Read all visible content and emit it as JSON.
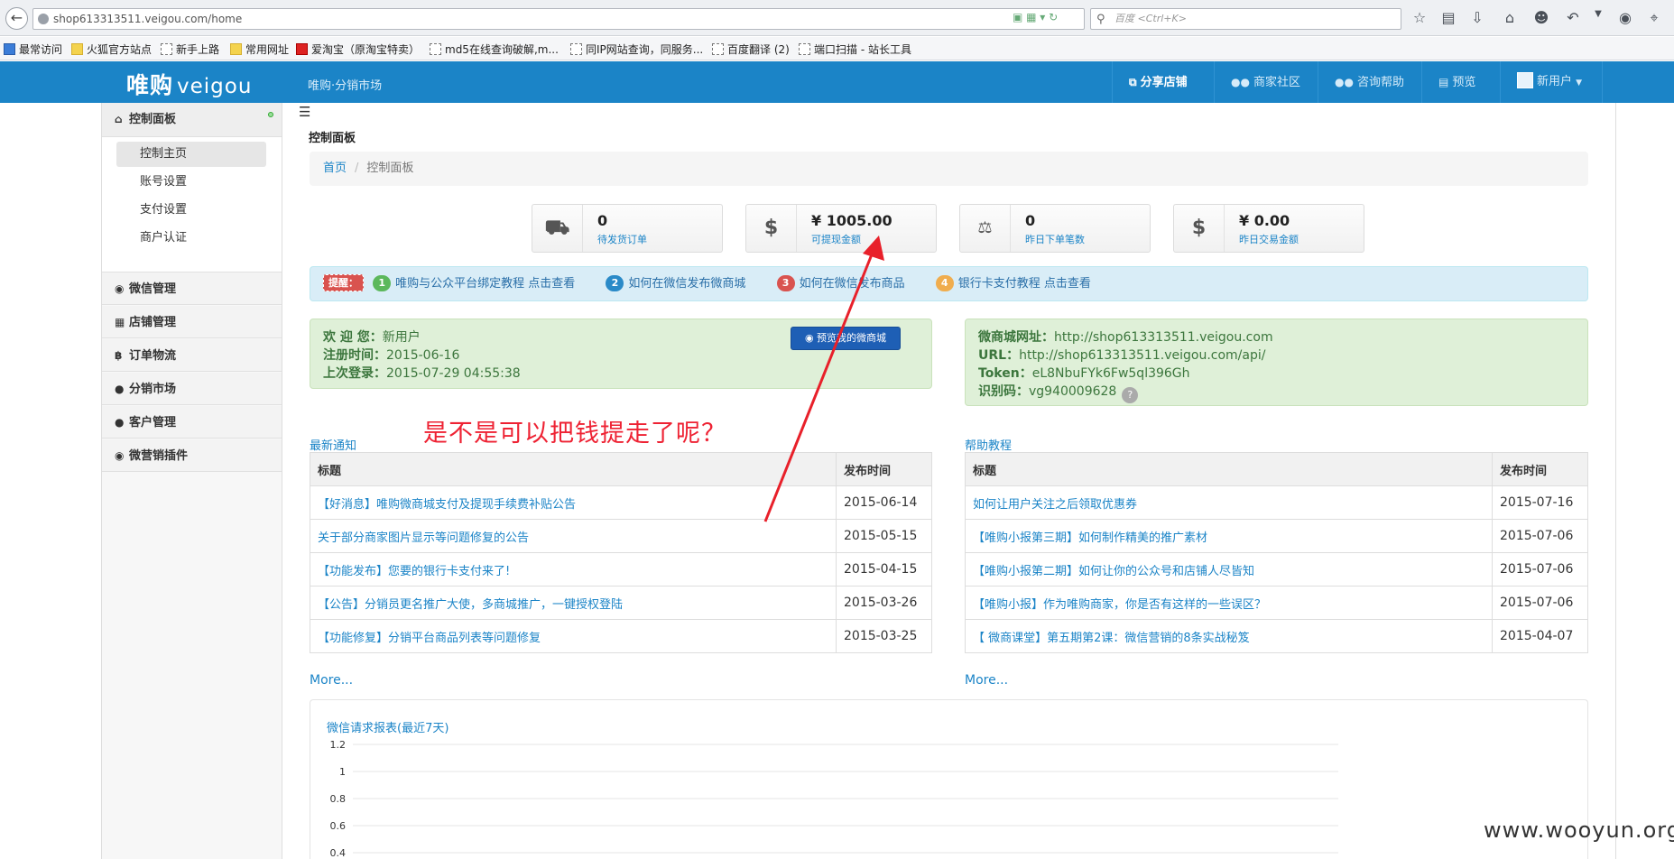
{
  "browser": {
    "url": "shop613313511.veigou.com/home",
    "search_placeholder": "百度 <Ctrl+K>"
  },
  "bookmarks": [
    {
      "label": "最常访问",
      "icon": "b"
    },
    {
      "label": "火狐官方站点",
      "icon": "f"
    },
    {
      "label": "新手上路",
      "icon": "d"
    },
    {
      "label": "常用网址",
      "icon": "f"
    },
    {
      "label": "爱淘宝（原淘宝特卖）",
      "icon": "r"
    },
    {
      "label": "md5在线查询破解,m...",
      "icon": "d"
    },
    {
      "label": "同IP网站查询，同服务...",
      "icon": "d"
    },
    {
      "label": "百度翻译 (2)",
      "icon": "d"
    },
    {
      "label": "端口扫描 - 站长工具",
      "icon": "d"
    }
  ],
  "header": {
    "logo_cn": "唯购",
    "logo_en": "veigou",
    "market": "唯购·分销市场",
    "nav": [
      {
        "label": "分享店铺",
        "icon": "share-icon"
      },
      {
        "label": "商家社区",
        "icon": "users-icon"
      },
      {
        "label": "咨询帮助",
        "icon": "users-icon"
      },
      {
        "label": "预览",
        "icon": "film-icon"
      },
      {
        "label": "新用户",
        "icon": "user-icon"
      }
    ]
  },
  "sidebar": {
    "panel": "控制面板",
    "subs": [
      "控制主页",
      "账号设置",
      "支付设置",
      "商户认证"
    ],
    "groups": [
      {
        "label": "微信管理",
        "icon": "chat-icon"
      },
      {
        "label": "店铺管理",
        "icon": "grid-icon"
      },
      {
        "label": "订单物流",
        "icon": "bitcoin-icon"
      },
      {
        "label": "分销市场",
        "icon": "users-icon"
      },
      {
        "label": "客户管理",
        "icon": "users-icon"
      },
      {
        "label": "微营销插件",
        "icon": "eye-icon"
      }
    ]
  },
  "page": {
    "title": "控制面板",
    "crumb_home": "首页",
    "crumb_current": "控制面板"
  },
  "stats": [
    {
      "value": "0",
      "label": "待发货订单",
      "icon": "truck-icon"
    },
    {
      "value": "¥ 1005.00",
      "label": "可提现金额",
      "icon": "dollar-icon"
    },
    {
      "value": "0",
      "label": "昨日下单笔数",
      "icon": "cart-icon"
    },
    {
      "value": "¥ 0.00",
      "label": "昨日交易金额",
      "icon": "dollar-icon"
    }
  ],
  "reminder": {
    "label": "提醒：",
    "items": [
      {
        "n": "1",
        "text": "唯购与公众平台绑定教程 点击查看",
        "color": "#5cb85c"
      },
      {
        "n": "2",
        "text": "如何在微信发布微商城",
        "color": "#2a8ac8"
      },
      {
        "n": "3",
        "text": "如何在微信发布商品",
        "color": "#d9534f"
      },
      {
        "n": "4",
        "text": "银行卡支付教程 点击查看",
        "color": "#f0ad4e"
      }
    ]
  },
  "welcome": {
    "k1": "欢 迎 您：",
    "v1": "新用户",
    "k2": "注册时间：",
    "v2": "2015-06-16",
    "k3": "上次登录：",
    "v3": "2015-07-29 04:55:38",
    "preview_btn": "预览我的微商城"
  },
  "shopinfo": {
    "k1": "微商城网址：",
    "v1": "http://shop613313511.veigou.com",
    "k2": "URL：",
    "v2": "http://shop613313511.veigou.com/api/",
    "k3": "Token：",
    "v3": "eL8NbuFYk6Fw5ql396Gh",
    "k4": "识别码：",
    "v4": "vg940009628",
    "q": "?"
  },
  "notices": {
    "title": "最新通知",
    "col1": "标题",
    "col2": "发布时间",
    "more": "More...",
    "rows": [
      {
        "t": "【好消息】唯购微商城支付及提现手续费补贴公告",
        "d": "2015-06-14"
      },
      {
        "t": "关于部分商家图片显示等问题修复的公告",
        "d": "2015-05-15"
      },
      {
        "t": "【功能发布】您要的银行卡支付来了!",
        "d": "2015-04-15"
      },
      {
        "t": "【公告】分销员更名推广大使，多商城推广，一键授权登陆",
        "d": "2015-03-26"
      },
      {
        "t": "【功能修复】分销平台商品列表等问题修复",
        "d": "2015-03-25"
      }
    ]
  },
  "help": {
    "title": "帮助教程",
    "col1": "标题",
    "col2": "发布时间",
    "more": "More...",
    "rows": [
      {
        "t": "如何让用户关注之后领取优惠券",
        "d": "2015-07-16"
      },
      {
        "t": "【唯购小报第三期】如何制作精美的推广素材",
        "d": "2015-07-06"
      },
      {
        "t": "【唯购小报第二期】如何让你的公众号和店铺人尽皆知",
        "d": "2015-07-06"
      },
      {
        "t": "【唯购小报】作为唯购商家，你是否有这样的一些误区？",
        "d": "2015-07-06"
      },
      {
        "t": "【 微商课堂】第五期第2课：微信营销的8条实战秘笈",
        "d": "2015-04-07"
      }
    ]
  },
  "chart_data": {
    "type": "line",
    "title": "微信请求报表(最近7天)",
    "yticks": [
      "1.2",
      "1",
      "0.8",
      "0.6",
      "0.4"
    ],
    "series": []
  },
  "annotation": "是不是可以把钱提走了呢？",
  "watermark": "www.wooyun.org"
}
